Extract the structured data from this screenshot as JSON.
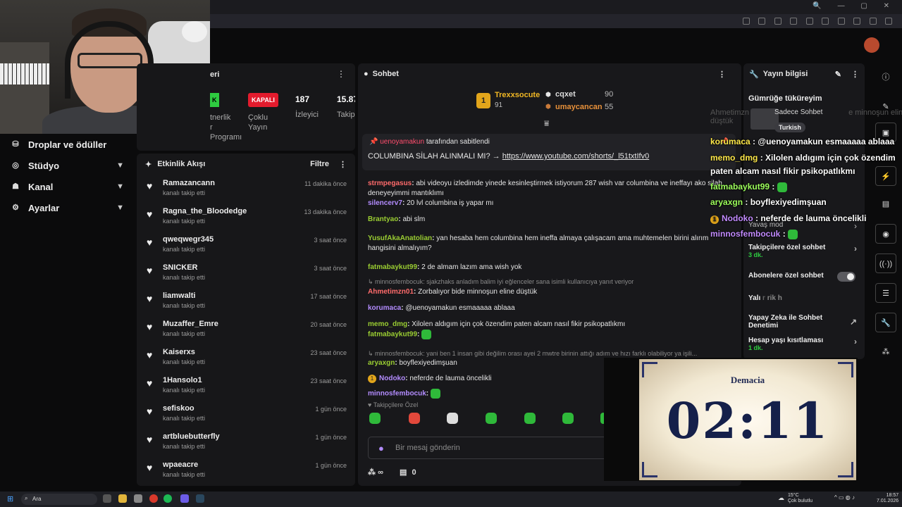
{
  "nav": {
    "items": [
      {
        "label": "Droplar ve ödüller",
        "chevron": false
      },
      {
        "label": "Stüdyo",
        "chevron": true
      },
      {
        "label": "Kanal",
        "chevron": true
      },
      {
        "label": "Ayarlar",
        "chevron": true
      }
    ]
  },
  "stats": {
    "title_fragment": "eri",
    "creator_label_1": "tnerlik",
    "creator_label_2": "r",
    "creator_label_3": "Programı",
    "status_badge": "KAPALI",
    "status_label_1": "Çoklu",
    "status_label_2": "Yayın",
    "viewers_value": "187",
    "viewers_label": "İzleyici",
    "followers_value": "15.87",
    "followers_label": "Takip"
  },
  "activity": {
    "title": "Etkinlik Akışı",
    "filter_label": "Filtre",
    "rows": [
      {
        "name": "Ramazancann",
        "action": "kanalı takip etti",
        "time": "11 dakika önce"
      },
      {
        "name": "Ragna_the_Bloodedge",
        "action": "kanalı takip etti",
        "time": "13 dakika önce"
      },
      {
        "name": "qweqwegr345",
        "action": "kanalı takip etti",
        "time": "3 saat önce"
      },
      {
        "name": "SNICKER",
        "action": "kanalı takip etti",
        "time": "3 saat önce"
      },
      {
        "name": "liamwalti",
        "action": "kanalı takip etti",
        "time": "17 saat önce"
      },
      {
        "name": "Muzaffer_Emre",
        "action": "kanalı takip etti",
        "time": "20 saat önce"
      },
      {
        "name": "Kaiserxs",
        "action": "kanalı takip etti",
        "time": "23 saat önce"
      },
      {
        "name": "1Hansolo1",
        "action": "kanalı takip etti",
        "time": "23 saat önce"
      },
      {
        "name": "sefiskoo",
        "action": "kanalı takip etti",
        "time": "1 gün önce"
      },
      {
        "name": "artbluebutterfly",
        "action": "kanalı takip etti",
        "time": "1 gün önce"
      },
      {
        "name": "wpaeacre",
        "action": "kanalı takip etti",
        "time": "1 gün önce"
      }
    ]
  },
  "chat": {
    "title": "Sohbet",
    "leaderboard": {
      "first": {
        "rank": "1",
        "name": "Trexxsocute",
        "points": "91"
      },
      "second": {
        "name": "cqxet",
        "points": "90"
      },
      "third": {
        "name": "umaycancan",
        "points": "55"
      }
    },
    "pinned": {
      "pinner": "uenoyamakun",
      "pinned_by_text": "tarafından sabitlendi",
      "message": "COLUMBINA SİLAH ALINMALI MI? →",
      "link": "https://www.youtube.com/shorts/_l51txtIfv0"
    },
    "messages": [
      {
        "user": "strmpegasus",
        "color": "#ff6b6b",
        "text": "abi videoyu izledimde yinede kesinleştirmek istiyorum 287 wish var columbina ve ineffayı ako silah deneyeyimmi mantıklımı"
      },
      {
        "user": "silencerv7",
        "color": "#b38cff",
        "text": "20 lvl columbina iş yapar mı"
      },
      {
        "user": "Brantyao",
        "color": "#9acd32",
        "text": "abi slm"
      },
      {
        "user": "YusufAkaAnatolian",
        "color": "#9acd32",
        "text": "yan hesaba hem columbina hem ineffa almaya çalışacam ama muhtemelen birini alırım hangisini almalıyım?"
      },
      {
        "user": "fatmabaykut99",
        "color": "#9acd32",
        "text": "2 de almam lazım ama wish yok"
      },
      {
        "reply_to": "minnosfembocuk: sjakzhaks anladım balim iyi eğlenceler sana isimli kullanıcıya yanıt veriyor"
      },
      {
        "user": "Ahmetimzn01",
        "color": "#ff6b6b",
        "text": "Zorbalıyor bide minnoşun eline düştük"
      },
      {
        "user": "korumaca",
        "color": "#b38cff",
        "text": "@uenoyamakun esmaaaaa ablaaa"
      },
      {
        "user": "memo_dmg",
        "color": "#9acd32",
        "text": "Xilolen aldıgım için çok özendim paten alcam nasıl fikir psikopatlıkmı"
      },
      {
        "user": "fatmabaykut99",
        "color": "#9acd32",
        "text": ""
      },
      {
        "reply_to": "minnosfembocuk: yani ben 1 insan gibi değilim orası ayei 2 mwtre birinin attığı adım ve hızı farklı olabiliyor ya işili..."
      },
      {
        "user": "aryaxgn",
        "color": "#9acd32",
        "text": "boyflexiyedimşuan"
      },
      {
        "user": "Nodoko",
        "color": "#b38cff",
        "text": "neferde de lauma öncelikli"
      },
      {
        "user": "minnosfembocuk",
        "color": "#b38cff",
        "text": ""
      }
    ],
    "emote_section_label": "Takipçilere Özel",
    "input_placeholder": "Bir mesaj gönderin",
    "footer_infinity": "∞",
    "footer_count": "0"
  },
  "stream_info": {
    "title": "Yayın bilgisi",
    "stream_title": "Gümrüğe tüküreyim",
    "chat_mode_label": "Sadece Sohbet",
    "language_badge": "Turkish",
    "slow_mode": "Yavaş mod",
    "followers_only": "Takipçilere özel sohbet",
    "followers_only_sub": "3 dk.",
    "subs_only": "Abonelere özel sohbet",
    "partial_setting": "Yalı",
    "partial_setting_end": "r",
    "partial_setting_mid": "rik h",
    "ai_moderation_1": "Yapay Zeka ile Sohbet",
    "ai_moderation_2": "Denetimi",
    "account_age": "Hesap yaşı kısıtlaması",
    "account_age_sub": "1 dk."
  },
  "overlay_chat": [
    {
      "user": "korumaca",
      "color": "#ffe94a",
      "text": "@uenoyamakun esmaaaaa ablaaa"
    },
    {
      "user": "memo_dmg",
      "color": "#ffe94a",
      "text": "Xilolen aldıgım için çok özendim"
    },
    {
      "user": "",
      "color": "#ffffff",
      "text": "paten alcam nasıl fikir psikopatlıkmı"
    },
    {
      "user": "fatmabaykut99",
      "color": "#9dff5c",
      "text": ""
    },
    {
      "user": "aryaxgn",
      "color": "#9dff5c",
      "text": "boyflexiyedimşuan"
    },
    {
      "user": "Nodoko",
      "color": "#c28bff",
      "text": "neferde de lauma öncelikli"
    },
    {
      "user": "minnosfembocuk",
      "color": "#c28bff",
      "text": ""
    }
  ],
  "overlay_ghost": {
    "line1": "Ahmetimzn",
    "line1_end": "e minnoşun eline",
    "line2": "düştük"
  },
  "timer": {
    "title": "Demacia",
    "value": "02:11"
  },
  "taskbar": {
    "search_placeholder": "Ara",
    "weather_temp": "15°C",
    "weather_text": "Çok bulutlu",
    "time": "18:57",
    "date": "7.01.2026"
  },
  "colors": {
    "accent_green": "#2ecc40",
    "live_badge_red": "#e31b2d",
    "link_color": "#ffffff"
  }
}
